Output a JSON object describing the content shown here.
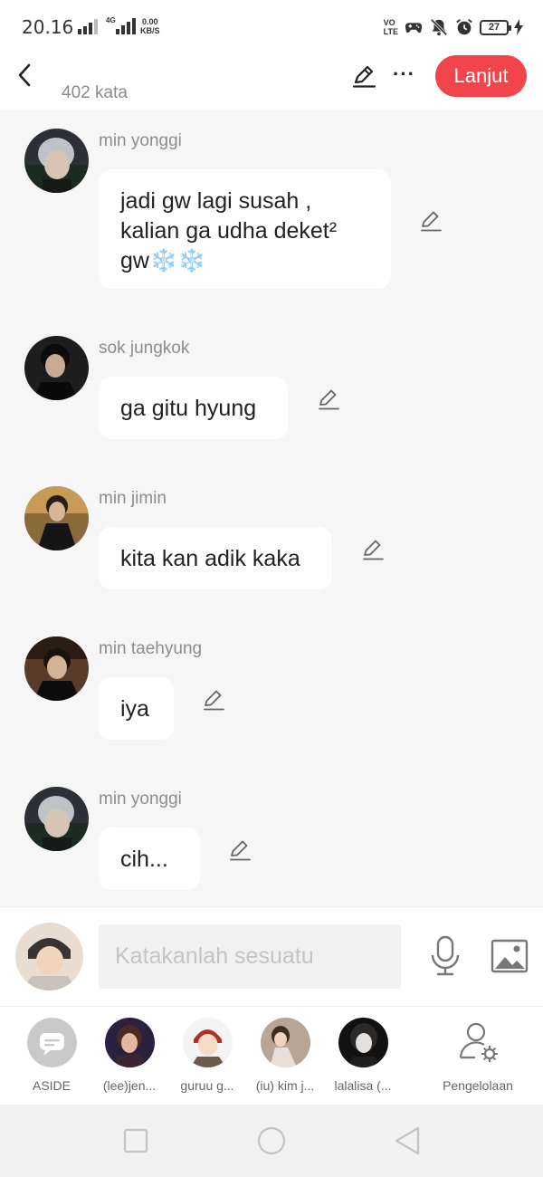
{
  "status_bar": {
    "time": "20.16",
    "network": "4G",
    "speed_value": "0.00",
    "speed_unit": "KB/S",
    "volte_top": "VO",
    "volte_bottom": "LTE",
    "battery": "27",
    "icons": [
      "signal-icon",
      "signal-icon",
      "game-controller-icon",
      "bell-off-icon",
      "alarm-icon",
      "battery-icon",
      "charging-icon"
    ]
  },
  "header": {
    "word_count": "402 kata",
    "next_label": "Lanjut",
    "more_label": "···",
    "accent_color": "#f1444b"
  },
  "messages": [
    {
      "sender": "min yonggi",
      "lines": [
        "jadi gw lagi susah ,",
        "kalian ga udha deket²",
        "gw❄️❄️"
      ]
    },
    {
      "sender": "sok jungkok",
      "lines": [
        "ga gitu hyung"
      ]
    },
    {
      "sender": "min jimin",
      "lines": [
        "kita kan adik kaka"
      ]
    },
    {
      "sender": "min taehyung",
      "lines": [
        "iya"
      ]
    },
    {
      "sender": "min yonggi",
      "lines": [
        "cih..."
      ]
    }
  ],
  "composer": {
    "placeholder": "Katakanlah sesuatu"
  },
  "characters": [
    {
      "label": "ASIDE"
    },
    {
      "label": "(lee)jen..."
    },
    {
      "label": "guruu g..."
    },
    {
      "label": "(iu) kim j..."
    },
    {
      "label": "lalalisa (..."
    },
    {
      "label": "Pengelolaan"
    }
  ]
}
